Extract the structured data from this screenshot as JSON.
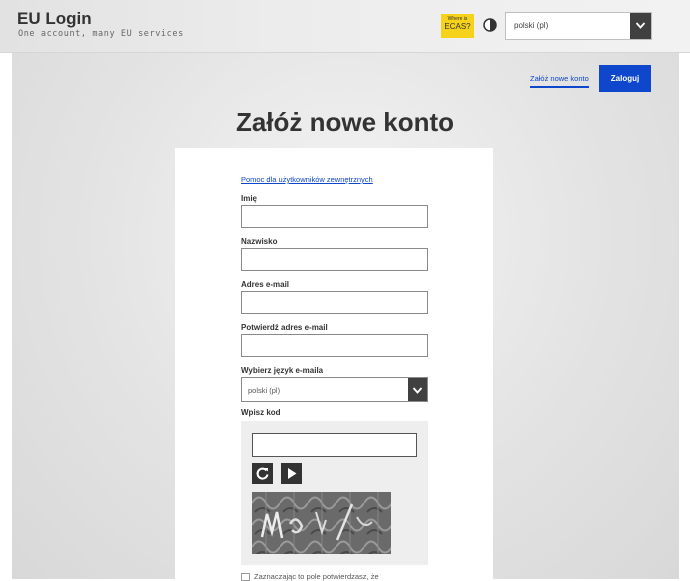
{
  "header": {
    "title": "EU Login",
    "subtitle": "One account, many EU services",
    "ecas_badge": {
      "line1": "Where is",
      "line2": "ECAS?"
    },
    "contrast_icon": "contrast-icon",
    "language_select": {
      "value": "polski (pl)",
      "icon": "chevron-down-icon"
    }
  },
  "nav": {
    "create_account": "Załóż nowe konto",
    "login": "Zaloguj"
  },
  "page": {
    "title": "Załóż nowe konto"
  },
  "form": {
    "help_link": "Pomoc dla użytkowników zewnętrznych",
    "first_name_label": "Imię",
    "last_name_label": "Nazwisko",
    "email_label": "Adres e-mail",
    "confirm_email_label": "Potwierdź adres e-mail",
    "email_language_label": "Wybierz język e-maila",
    "email_language_value": "polski (pl)",
    "captcha_label": "Wpisz kod",
    "checkbox_label": "Zaznaczając to pole potwierdzasz, że"
  },
  "colors": {
    "accent": "#0e47cb",
    "badge": "#f7d21b",
    "dark": "#404040"
  }
}
